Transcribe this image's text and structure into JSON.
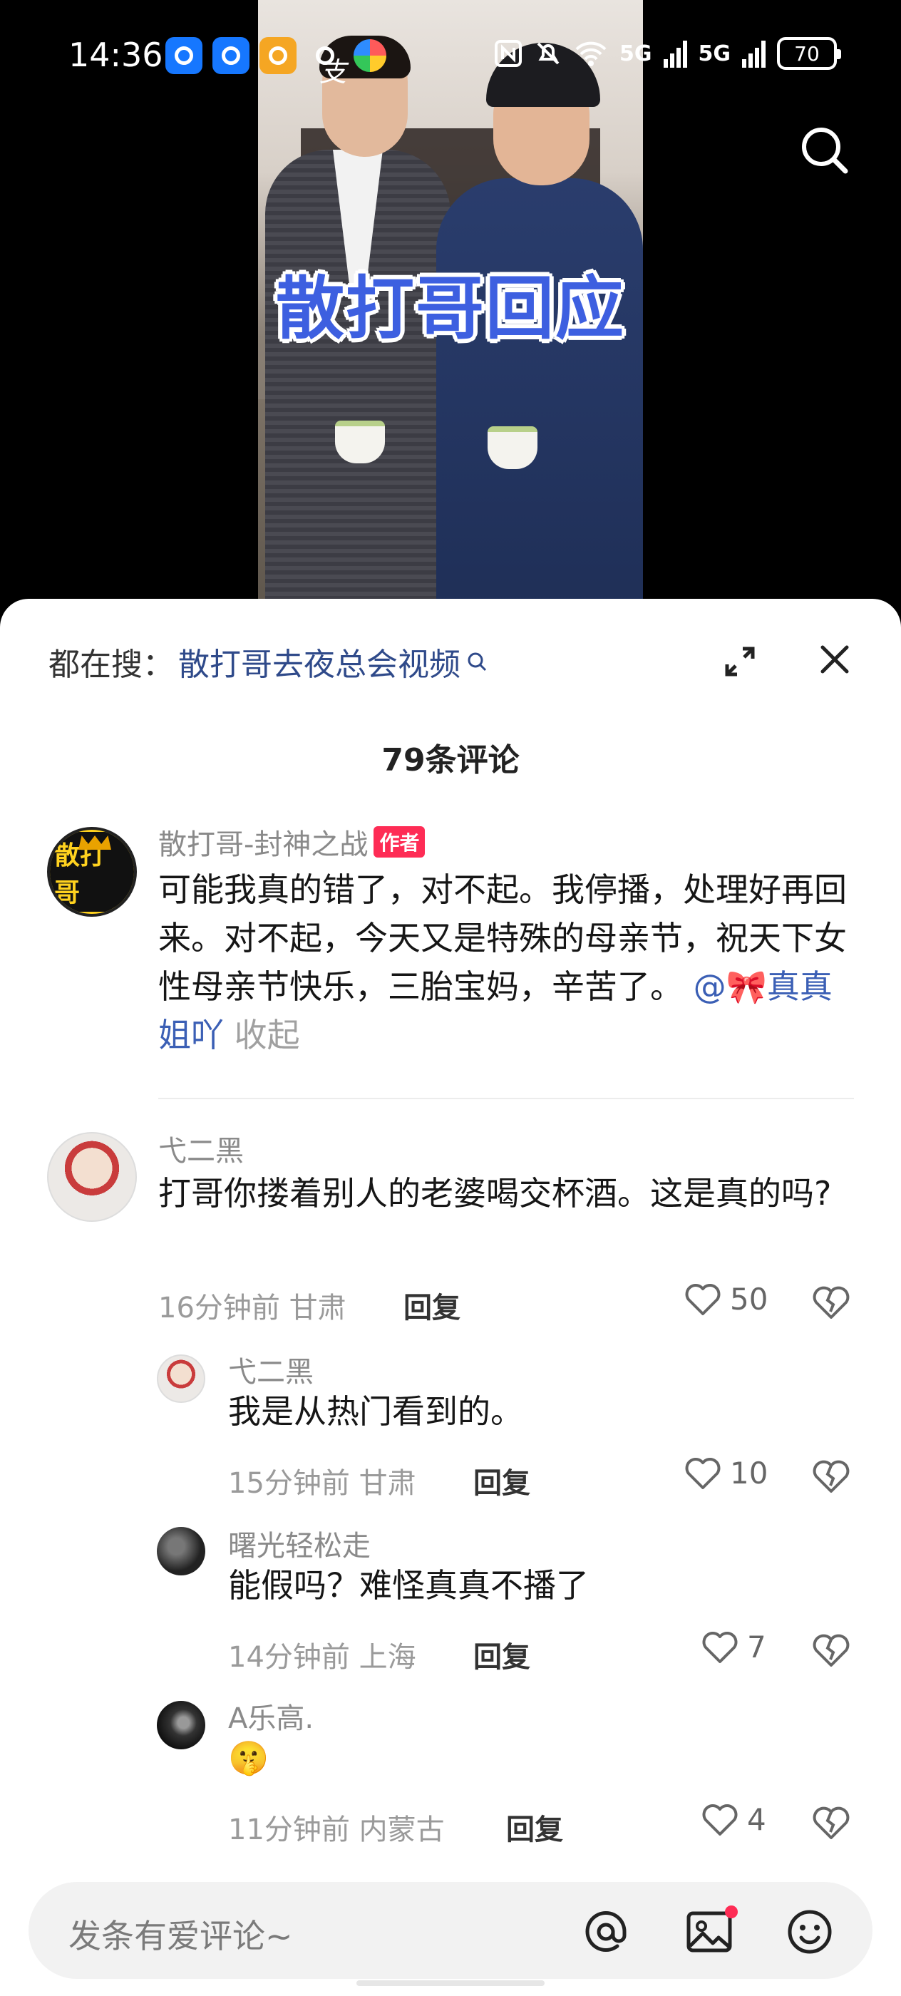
{
  "status_bar": {
    "time": "14:36",
    "network_1": "5G",
    "network_2": "5G",
    "battery": "70"
  },
  "video": {
    "overlay_title": "散打哥回应"
  },
  "sheet": {
    "hot_label": "都在搜：",
    "hot_query": "散打哥去夜总会视频",
    "comment_count": "79条评论"
  },
  "author_comment": {
    "name": "散打哥-封神之战",
    "avatar_text": "散打哥",
    "tag": "作者",
    "text": "可能我真的错了，对不起。我停播，处理好再回来。对不起，今天又是特殊的母亲节，祝天下女性母亲节快乐，三胎宝妈，辛苦了。",
    "mention": "@🎀真真姐吖",
    "collapse": "收起"
  },
  "comments": [
    {
      "name": "弋二黑",
      "text": "打哥你搂着别人的老婆喝交杯酒。这是真的吗?",
      "time": "16分钟前",
      "location": "甘肃",
      "reply": "回复",
      "likes": "50"
    }
  ],
  "replies": [
    {
      "name": "弋二黑",
      "text": "我是从热门看到的。",
      "time": "15分钟前",
      "location": "甘肃",
      "reply": "回复",
      "likes": "10"
    },
    {
      "name": "曙光轻松走",
      "text": "能假吗？难怪真真不播了",
      "time": "14分钟前",
      "location": "上海",
      "reply": "回复",
      "likes": "7"
    },
    {
      "name": "A乐高.",
      "text": "🤫",
      "time": "11分钟前",
      "location": "内蒙古",
      "reply": "回复",
      "likes": "4"
    }
  ],
  "input": {
    "placeholder": "发条有爱评论~"
  },
  "icons": {
    "search": "search-icon",
    "expand": "expand-icon",
    "close": "close-icon",
    "heart": "heart-icon",
    "dislike": "broken-heart-icon",
    "at": "at-icon",
    "image": "image-icon",
    "emoji": "emoji-icon"
  },
  "colors": {
    "accent_red": "#fe2c55",
    "link_blue": "#3b5fb5",
    "overlay_blue": "#3d5fe0"
  }
}
